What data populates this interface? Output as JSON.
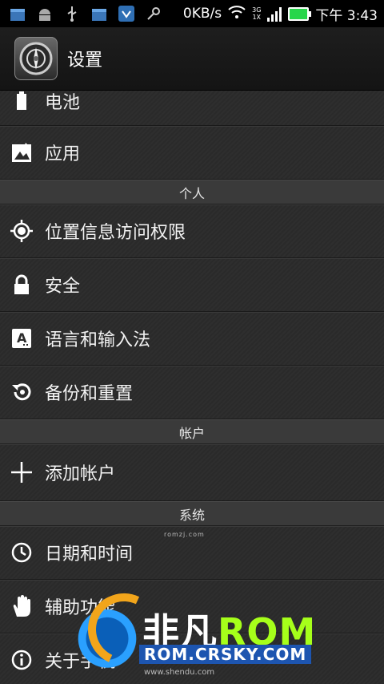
{
  "status_bar": {
    "speed": "0KB/s",
    "network_top": "3G",
    "network_bottom": "1X",
    "time": "下午 3:43",
    "icons": [
      "bag-icon",
      "android-icon",
      "usb-icon",
      "bag-icon",
      "shield-icon",
      "key-icon",
      "wifi-icon",
      "signal-icon",
      "battery-icon"
    ]
  },
  "header": {
    "title": "设置"
  },
  "sections": {
    "personal": "个人",
    "accounts": "帐户",
    "system": "系统"
  },
  "items": {
    "battery": "电池",
    "apps": "应用",
    "location": "位置信息访问权限",
    "security": "安全",
    "language": "语言和输入法",
    "backup": "备份和重置",
    "add_account": "添加帐户",
    "date_time": "日期和时间",
    "accessibility": "辅助功能",
    "about": "关于手机"
  },
  "overlay": {
    "romzj": "romzj.com",
    "wm_title_a": "非凡",
    "wm_title_b": "ROM",
    "wm_url": "ROM.CRSKY.COM",
    "wm_sub": "www.shendu.com"
  }
}
